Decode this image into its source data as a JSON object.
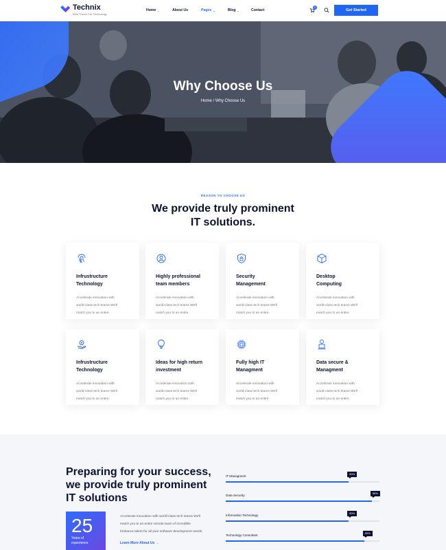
{
  "header": {
    "brand": "Technix",
    "tagline": "Best Theme For Technology",
    "nav": [
      {
        "label": "Home",
        "has_dropdown": true,
        "active": false
      },
      {
        "label": "About Us",
        "has_dropdown": false,
        "active": false
      },
      {
        "label": "Pages",
        "has_dropdown": true,
        "active": true
      },
      {
        "label": "Blog",
        "has_dropdown": true,
        "active": false
      },
      {
        "label": "Contact",
        "has_dropdown": false,
        "active": false
      }
    ],
    "cart_count": "0",
    "cta_label": "Get Started",
    "accent_color": "#1f66f3"
  },
  "hero": {
    "title": "Why Choose Us",
    "breadcrumb": "Home / Why Choose Us"
  },
  "features": {
    "eyebrow": "REASON TO CHOOSE US",
    "title_line1": "We provide truly prominent",
    "title_line2": "IT solutions.",
    "cards": [
      {
        "icon": "fingerprint-icon",
        "title_l1": "Infrustructure",
        "title_l2": "Technology",
        "desc_l1": "Accelerate innovation with",
        "desc_l2": "world-class tech teams We'll",
        "desc_l3": "match you to an entire."
      },
      {
        "icon": "team-icon",
        "title_l1": "Highly professional",
        "title_l2": "team members",
        "desc_l1": "Accelerate innovation with",
        "desc_l2": "world-class tech teams We'll",
        "desc_l3": "match you to an entire."
      },
      {
        "icon": "shield-lock-icon",
        "title_l1": "Security",
        "title_l2": "Management",
        "desc_l1": "Accelerate innovation with",
        "desc_l2": "world-class tech teams We'll",
        "desc_l3": "match you to an entire."
      },
      {
        "icon": "cube-icon",
        "title_l1": "Desktop",
        "title_l2": "Computing",
        "desc_l1": "Accelerate innovation with",
        "desc_l2": "world-class tech teams We'll",
        "desc_l3": "match you to an entire."
      },
      {
        "icon": "hand-gear-icon",
        "title_l1": "Infrustructure",
        "title_l2": "Technology",
        "desc_l1": "Accelerate innovation with",
        "desc_l2": "world-class tech teams We'll",
        "desc_l3": "match you to an entire."
      },
      {
        "icon": "lightbulb-icon",
        "title_l1": "Ideas for high return",
        "title_l2": "investment",
        "desc_l1": "Accelerate innovation with",
        "desc_l2": "world-class tech teams We'll",
        "desc_l3": "match you to an entire."
      },
      {
        "icon": "chip-icon",
        "title_l1": "Fully high IT",
        "title_l2": "Managment",
        "desc_l1": "Accelerate innovation with",
        "desc_l2": "world-class tech teams We'll",
        "desc_l3": "match you to an entire."
      },
      {
        "icon": "user-laptop-icon",
        "title_l1": "Data secure &",
        "title_l2": "Managment",
        "desc_l1": "Accelerate innovation with",
        "desc_l2": "world-class tech teams We'll",
        "desc_l3": "match you to an entire."
      }
    ]
  },
  "success": {
    "title_l1": "Preparing for your success,",
    "title_l2": "we provide truly prominent",
    "title_l3": "IT solutions",
    "years": "25",
    "years_l1": "Years of",
    "years_l2": "experience",
    "text_l1": "Accelerate innovation with world-class tech teams We'll",
    "text_l2": "match you to an entire remote team of incredible",
    "text_l3": "freelance talent for all your software development needs.",
    "link": "Learn More About Us →",
    "skills": [
      {
        "name": "IT Managment",
        "percent": 80,
        "label": "80%"
      },
      {
        "name": "Data Security",
        "percent": 95,
        "label": "95%"
      },
      {
        "name": "Information Technology",
        "percent": 80,
        "label": "80%"
      },
      {
        "name": "Technology Consultant",
        "percent": 90,
        "label": "90%"
      }
    ]
  }
}
